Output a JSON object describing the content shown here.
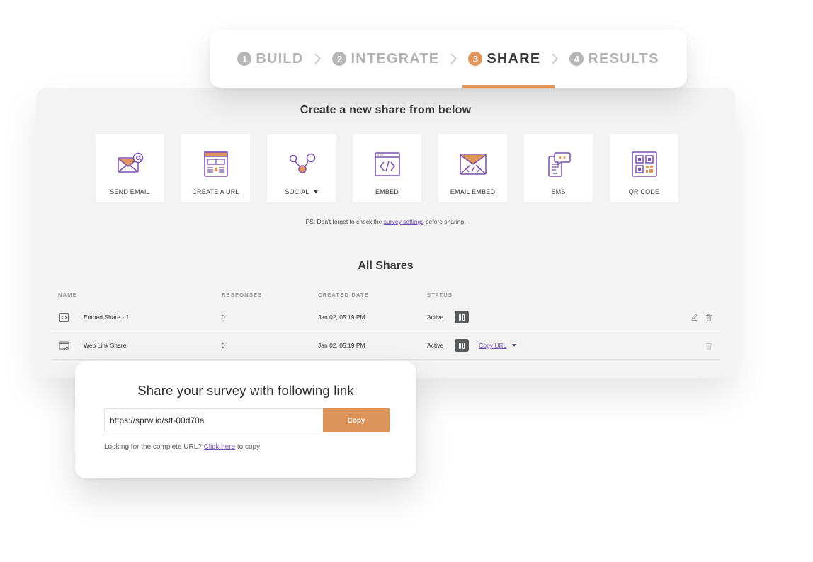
{
  "stepper": {
    "steps": [
      {
        "num": "1",
        "label": "BUILD"
      },
      {
        "num": "2",
        "label": "INTEGRATE"
      },
      {
        "num": "3",
        "label": "SHARE"
      },
      {
        "num": "4",
        "label": "RESULTS"
      }
    ],
    "active_step": "SHARE",
    "accent": "#e0955b"
  },
  "create": {
    "title": "Create a new share from below",
    "tiles": [
      {
        "label": "SEND EMAIL",
        "icon": "email-icon"
      },
      {
        "label": "CREATE A URL",
        "icon": "url-icon"
      },
      {
        "label": "SOCIAL",
        "icon": "social-icon"
      },
      {
        "label": "EMBED",
        "icon": "embed-icon"
      },
      {
        "label": "EMAIL EMBED",
        "icon": "email-embed-icon"
      },
      {
        "label": "SMS",
        "icon": "sms-icon"
      },
      {
        "label": "QR CODE",
        "icon": "qr-code-icon"
      }
    ],
    "ps": {
      "prefix": "PS: Don't forget to check the ",
      "link": "survey settings",
      "suffix": " before sharing."
    }
  },
  "shares": {
    "title": "All Shares",
    "columns": [
      "NAME",
      "RESPONSES",
      "CREATED DATE",
      "STATUS"
    ],
    "rows": [
      {
        "name": "Embed Share - 1",
        "responses": "0",
        "created": "Jan 02, 05:19 PM",
        "status": "Active",
        "icon": "embed-icon"
      },
      {
        "name": "Web Link Share",
        "responses": "0",
        "created": "Jan 02, 05:19 PM",
        "status": "Active",
        "icon": "web-link-icon",
        "action": "Copy URL"
      }
    ]
  },
  "link_card": {
    "title": "Share your survey with following link",
    "url": "https://sprw.io/stt-00d70a",
    "copy_label": "Copy",
    "hint_prefix": "Looking for the complete URL? ",
    "hint_link": "Click here",
    "hint_suffix": " to copy"
  },
  "colors": {
    "accent_orange": "#dd945b",
    "icon_purple": "#7b4fb1",
    "link_purple": "#7b4fb1"
  }
}
